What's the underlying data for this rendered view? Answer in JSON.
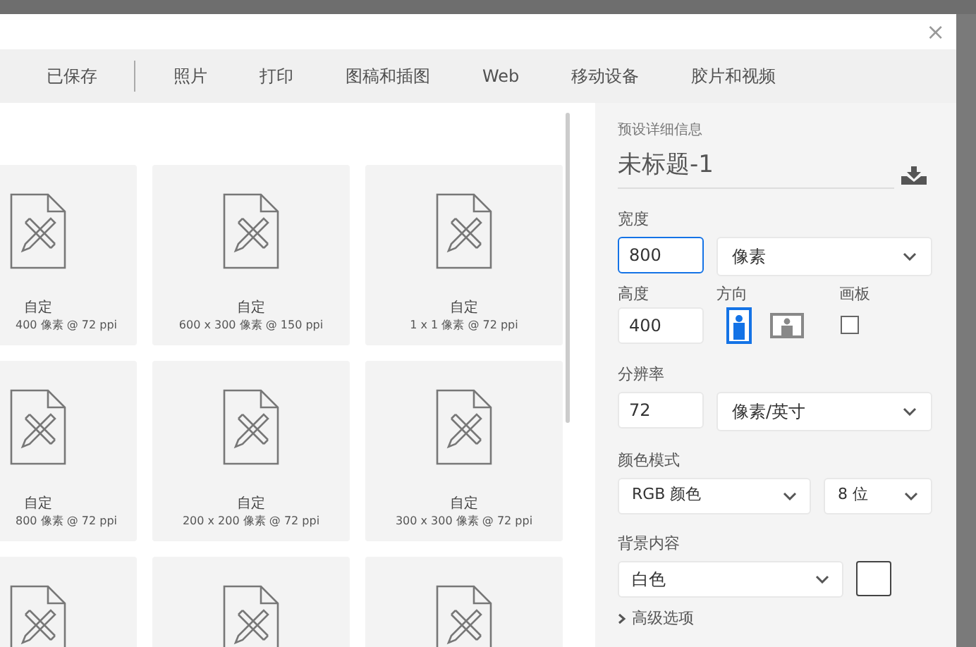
{
  "dialog": {
    "close_glyph": "×"
  },
  "tabs": [
    {
      "label": "已保存",
      "selected": false
    },
    {
      "label": "照片",
      "selected": false
    },
    {
      "label": "打印",
      "selected": false
    },
    {
      "label": "图稿和插图",
      "selected": false
    },
    {
      "label": "Web",
      "selected": false
    },
    {
      "label": "移动设备",
      "selected": false
    },
    {
      "label": "胶片和视频",
      "selected": false
    }
  ],
  "presets": [
    [
      {
        "kind": "labeled",
        "title": "自定",
        "size": "400 像素 @ 72 ppi"
      },
      {
        "kind": "labeled",
        "title": "自定",
        "size": "600 x 300 像素 @ 150 ppi"
      },
      {
        "kind": "labeled",
        "title": "自定",
        "size": "1 x 1 像素 @ 72 ppi"
      }
    ],
    [
      {
        "kind": "labeled",
        "title": "自定",
        "size": "800 像素 @ 72 ppi"
      },
      {
        "kind": "labeled",
        "title": "自定",
        "size": "200 x 200 像素 @ 72 ppi"
      },
      {
        "kind": "labeled",
        "title": "自定",
        "size": "300 x 300 像素 @ 72 ppi"
      }
    ],
    [
      {
        "kind": "icon_only"
      },
      {
        "kind": "icon_only"
      },
      {
        "kind": "icon_only"
      }
    ]
  ],
  "details": {
    "heading": "预设详细信息",
    "name": "未标题-1",
    "width": {
      "label": "宽度",
      "value": "800",
      "focused": true,
      "unit": "像素"
    },
    "height": {
      "label": "高度",
      "value": "400"
    },
    "orientation": {
      "label": "方向",
      "options": [
        {
          "kind": "portrait",
          "selected": true
        },
        {
          "kind": "landscape",
          "selected": false
        }
      ]
    },
    "artboard": {
      "label": "画板",
      "checked": false
    },
    "resolution": {
      "label": "分辨率",
      "value": "72",
      "unit": "像素/英寸"
    },
    "color_mode": {
      "label": "颜色模式",
      "mode": "RGB 颜色",
      "depth": "8 位"
    },
    "background": {
      "label": "背景内容",
      "value": "白色"
    },
    "advanced": {
      "label": "高级选项",
      "expanded": false
    }
  }
}
